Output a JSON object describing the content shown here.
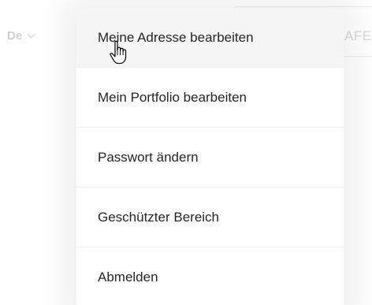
{
  "header": {
    "language": "De",
    "field_text": "AFE"
  },
  "menu": {
    "items": [
      {
        "label": "Meine Adresse bearbeiten",
        "hovered": true
      },
      {
        "label": "Mein Portfolio bearbeiten",
        "hovered": false
      },
      {
        "label": "Passwort ändern",
        "hovered": false
      },
      {
        "label": "Geschützter Bereich",
        "hovered": false
      },
      {
        "label": "Abmelden",
        "hovered": false
      }
    ]
  },
  "icons": {
    "cursor": "hand-pointer-cursor-icon",
    "language_chevron": "chevron-down-icon"
  },
  "colors": {
    "menu_text": "#262626",
    "hover_background": "#f5f5f5",
    "divider": "#efefef",
    "faded_text": "#d0d0d0"
  }
}
